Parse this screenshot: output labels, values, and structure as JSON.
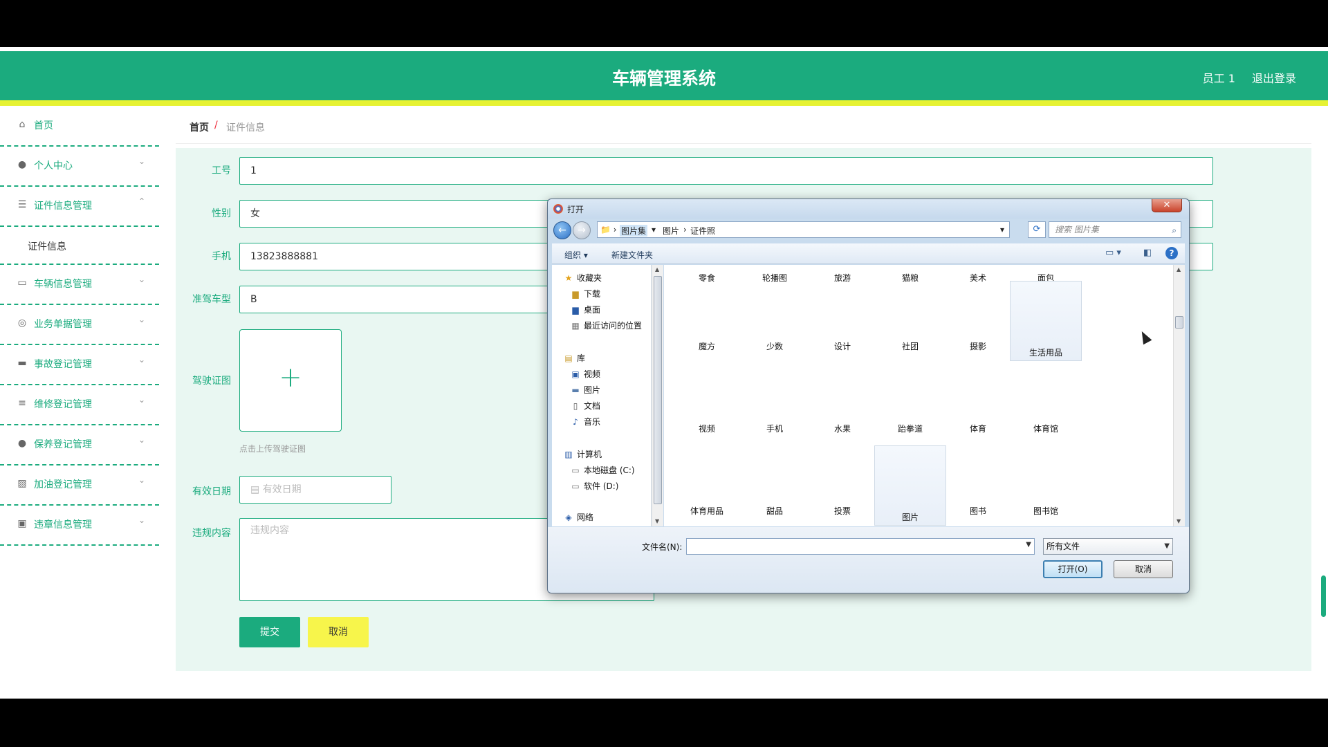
{
  "header": {
    "title": "车辆管理系统",
    "user": "员工 1",
    "logout": "退出登录"
  },
  "sidebar": {
    "items": [
      {
        "label": "首页",
        "icon": "home-icon"
      },
      {
        "label": "个人中心",
        "icon": "user-icon"
      },
      {
        "label": "证件信息管理",
        "icon": "menu-icon"
      },
      {
        "label": "证件信息",
        "icon": ""
      },
      {
        "label": "车辆信息管理",
        "icon": "chat-icon"
      },
      {
        "label": "业务单据管理",
        "icon": "compass-icon"
      },
      {
        "label": "事故登记管理",
        "icon": "message-icon"
      },
      {
        "label": "维修登记管理",
        "icon": "list-icon"
      },
      {
        "label": "保养登记管理",
        "icon": "user-icon"
      },
      {
        "label": "加油登记管理",
        "icon": "chart-icon"
      },
      {
        "label": "违章信息管理",
        "icon": "trash-icon"
      }
    ]
  },
  "breadcrumb": {
    "home": "首页",
    "sep": "/",
    "current": "证件信息"
  },
  "form": {
    "employee_id_label": "工号",
    "employee_id_value": "1",
    "gender_label": "性别",
    "gender_value": "女",
    "phone_label": "手机",
    "phone_value": "13823888881",
    "license_type_label": "准驾车型",
    "license_type_value": "B",
    "license_photo_label": "驾驶证图",
    "upload_hint": "点击上传驾驶证图",
    "valid_date_label": "有效日期",
    "valid_date_placeholder": "有效日期",
    "violation_label": "违规内容",
    "violation_placeholder": "违规内容",
    "submit": "提交",
    "cancel": "取消"
  },
  "dialog": {
    "title": "打开",
    "close": "✕",
    "address": [
      "图片集",
      "图片",
      "证件照"
    ],
    "search_placeholder": "搜索 图片集",
    "toolbar": {
      "organize": "组织 ▾",
      "new_folder": "新建文件夹"
    },
    "nav": {
      "favorites": "收藏夹",
      "downloads": "下载",
      "desktop": "桌面",
      "recent": "最近访问的位置",
      "library": "库",
      "videos": "视频",
      "pictures": "图片",
      "documents": "文档",
      "music": "音乐",
      "computer": "计算机",
      "drive_c": "本地磁盘 (C:)",
      "drive_d": "软件 (D:)",
      "network": "网络"
    },
    "files_row0": [
      "零食",
      "轮播图",
      "旅游",
      "猫粮",
      "美术",
      "面包"
    ],
    "files_row1": [
      "魔方",
      "少数",
      "设计",
      "社团",
      "摄影",
      "生活用品"
    ],
    "files_row2": [
      "视频",
      "手机",
      "水果",
      "跆拳道",
      "体育",
      "体育馆"
    ],
    "files_row3": [
      "体育用品",
      "甜品",
      "投票",
      "图片",
      "图书",
      "图书馆"
    ],
    "filename_label": "文件名(N):",
    "filetype": "所有文件",
    "open_button": "打开(O)",
    "cancel_button": "取消"
  }
}
